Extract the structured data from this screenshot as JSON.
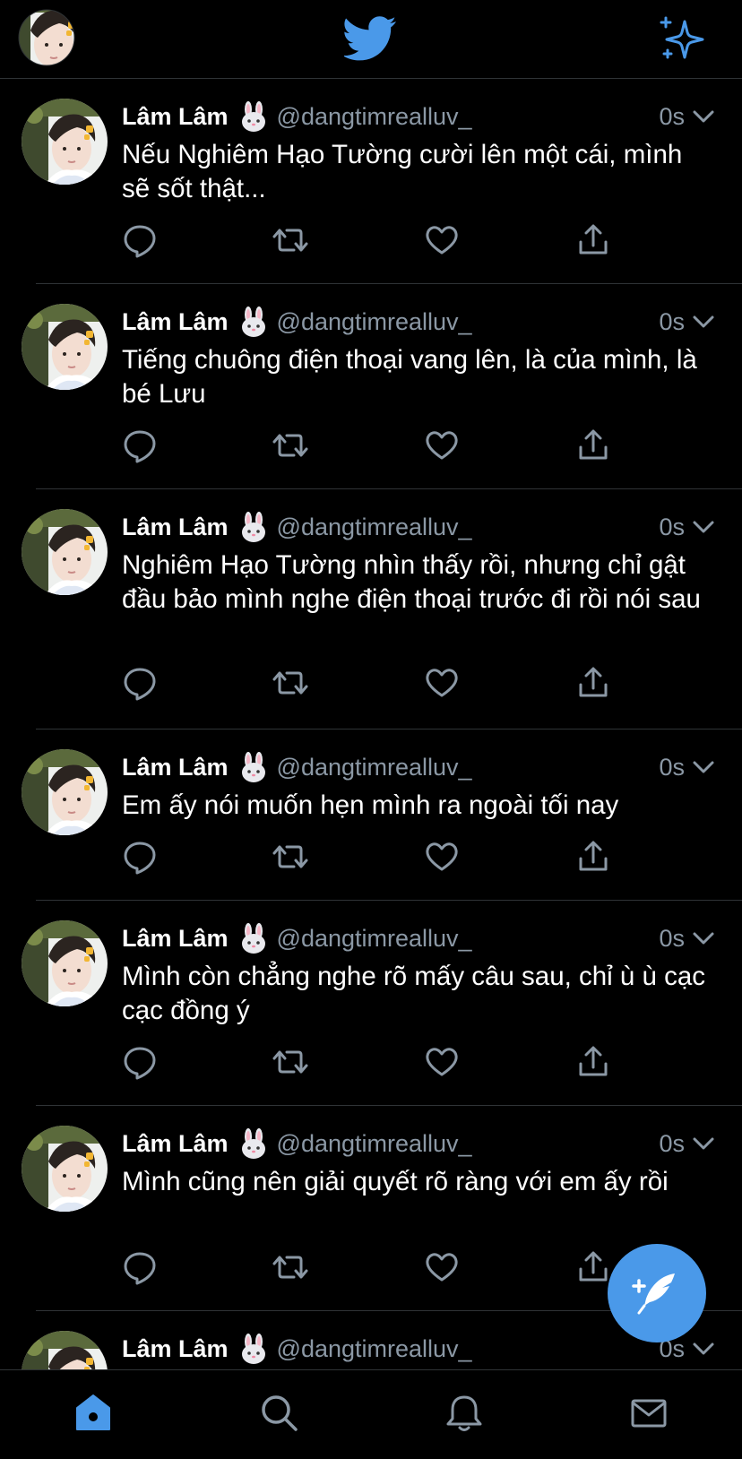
{
  "colors": {
    "accent": "#4a99e9",
    "background": "#000000",
    "secondary_text": "#8b98a5",
    "divider": "#2f3336"
  },
  "header": {
    "left_icon": "profile-avatar",
    "center_icon": "twitter-bird-icon",
    "right_icon": "sparkle-icon"
  },
  "tweets": [
    {
      "display_name": "Lâm Lâm",
      "emoji": "🐰",
      "handle": "@dangtimrealluv_",
      "time": "0s",
      "text": "Nếu Nghiêm Hạo Tường cười lên một cái, mình sẽ sốt thật..."
    },
    {
      "display_name": "Lâm Lâm",
      "emoji": "🐰",
      "handle": "@dangtimrealluv_",
      "time": "0s",
      "text": "Tiếng chuông điện thoại vang lên, là của mình, là bé Lưu"
    },
    {
      "display_name": "Lâm Lâm",
      "emoji": "🐰",
      "handle": "@dangtimrealluv_",
      "time": "0s",
      "text": "Nghiêm Hạo Tường nhìn thấy rồi, nhưng chỉ gật đầu bảo mình nghe điện thoại trước đi rồi nói sau"
    },
    {
      "display_name": "Lâm Lâm",
      "emoji": "🐰",
      "handle": "@dangtimrealluv_",
      "time": "0s",
      "text": "Em ấy nói muốn hẹn mình ra ngoài tối nay"
    },
    {
      "display_name": "Lâm Lâm",
      "emoji": "🐰",
      "handle": "@dangtimrealluv_",
      "time": "0s",
      "text": "Mình còn chẳng nghe rõ mấy câu sau, chỉ ù ù cạc cạc đồng ý"
    },
    {
      "display_name": "Lâm Lâm",
      "emoji": "🐰",
      "handle": "@dangtimrealluv_",
      "time": "0s",
      "text": "Mình cũng nên giải quyết rõ ràng với em ấy rồi"
    },
    {
      "display_name": "Lâm Lâm",
      "emoji": "🐰",
      "handle": "@dangtimrealluv_",
      "time": "0s",
      "text": ""
    }
  ],
  "bottom_nav": [
    "home-icon",
    "search-icon",
    "notifications-icon",
    "messages-icon"
  ],
  "fab": {
    "icon": "compose-tweet-icon"
  }
}
